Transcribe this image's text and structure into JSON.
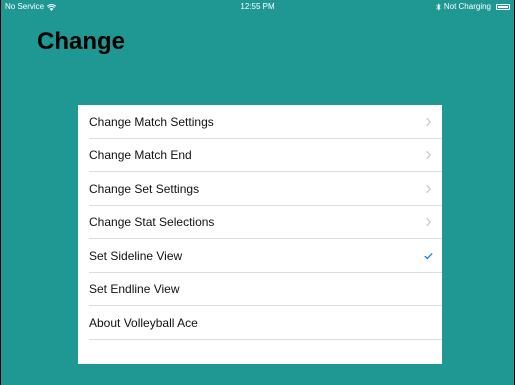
{
  "status_bar": {
    "carrier": "No Service",
    "time": "12:55 PM",
    "charging": "Not Charging",
    "wifi_icon": "wifi-icon",
    "bluetooth_icon": "bluetooth-icon",
    "battery_icon": "battery-icon"
  },
  "header": {
    "title": "Change"
  },
  "menu": {
    "items": [
      {
        "label": "Change Match Settings",
        "accessory": "chevron-right-icon"
      },
      {
        "label": "Change Match End",
        "accessory": "chevron-right-icon"
      },
      {
        "label": "Change Set Settings",
        "accessory": "chevron-right-icon"
      },
      {
        "label": "Change Stat Selections",
        "accessory": "chevron-right-icon"
      },
      {
        "label": "Set Sideline View",
        "accessory": "checkmark-icon",
        "selected": true
      },
      {
        "label": "Set Endline View",
        "accessory": ""
      },
      {
        "label": "About Volleyball Ace",
        "accessory": ""
      }
    ]
  },
  "colors": {
    "background": "#1f9893",
    "panel": "#ffffff",
    "separator": "#dcdcdc",
    "chevron": "#c7c7cc",
    "checkmark": "#1a7ef2"
  }
}
